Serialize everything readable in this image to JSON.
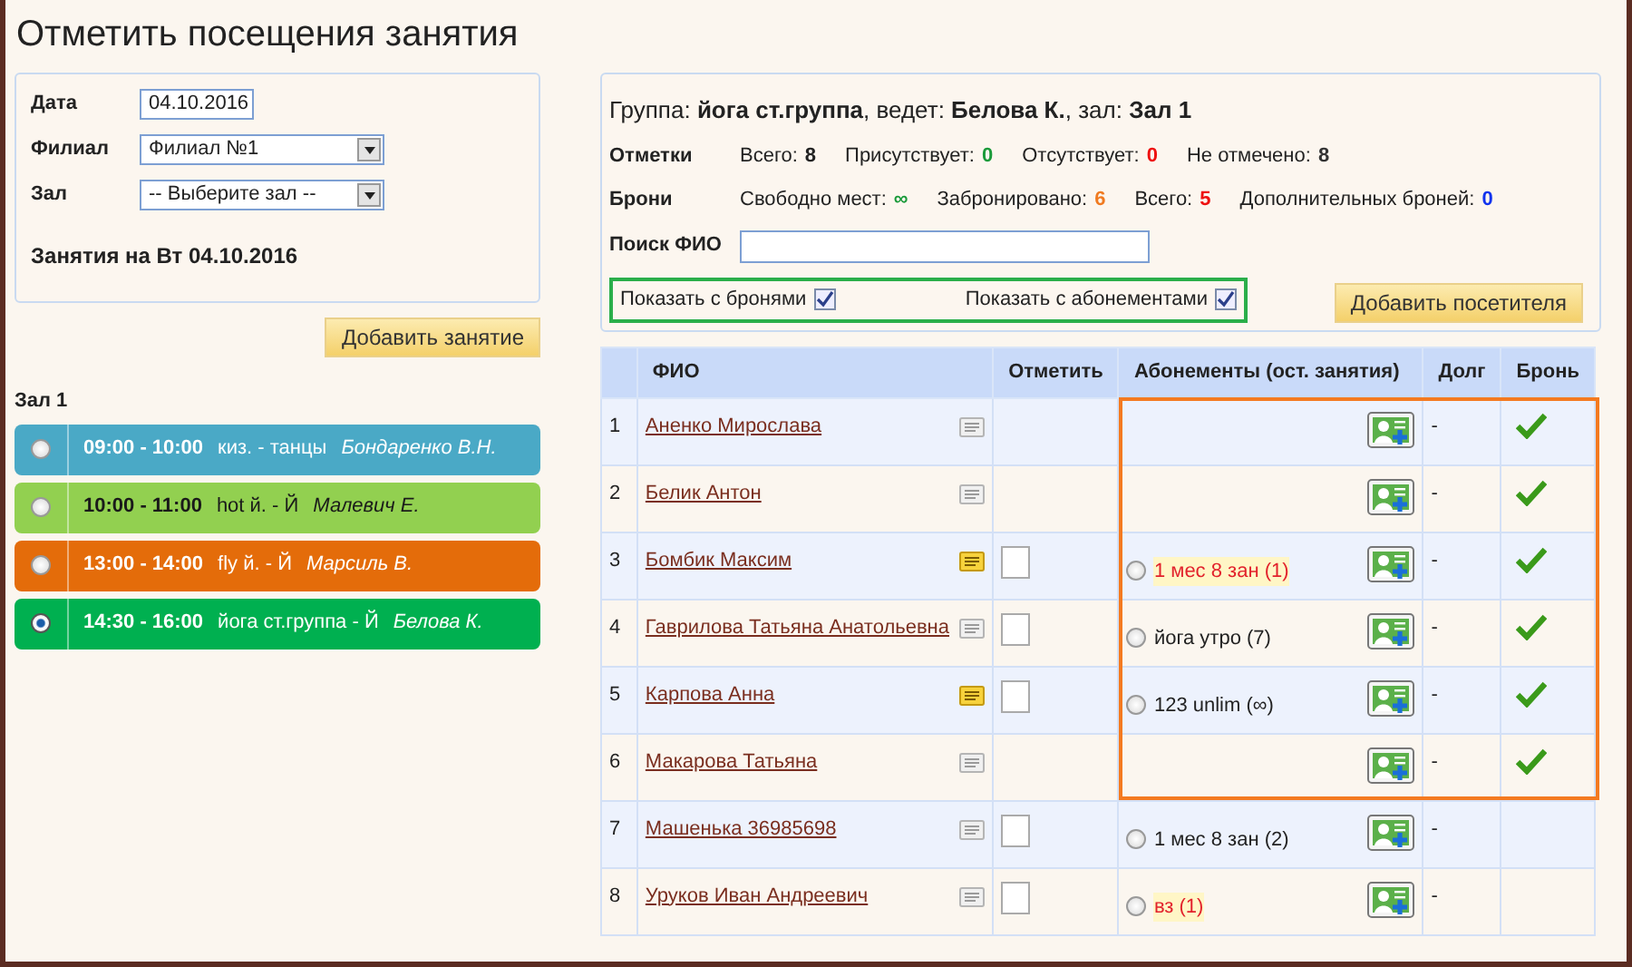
{
  "title": "Отметить посещения занятия",
  "filter": {
    "fields": [
      {
        "kind": "input",
        "label": "Дата",
        "value": "04.10.2016"
      },
      {
        "kind": "select",
        "label": "Филиал",
        "value": "Филиал №1"
      },
      {
        "kind": "select",
        "label": "Зал",
        "value": "-- Выберите зал --"
      }
    ],
    "heading": "Занятия на Вт 04.10.2016"
  },
  "add_lesson_button": "Добавить занятие",
  "hall_name": "Зал 1",
  "lessons": [
    {
      "time": "09:00 - 10:00",
      "name": "киз. - танцы",
      "teacher": "Бондаренко В.Н.",
      "color": "#4aa9c6",
      "selected": false
    },
    {
      "time": "10:00 - 11:00",
      "name": "hot й. - Й",
      "teacher": "Малевич Е.",
      "color": "#92d050",
      "selected": false
    },
    {
      "time": "13:00 - 14:00",
      "name": "fly й. - Й",
      "teacher": "Марсиль В.",
      "color": "#e46c0a",
      "selected": false
    },
    {
      "time": "14:30 - 16:00",
      "name": "йога ст.группа - Й",
      "teacher": "Белова К.",
      "color": "#00b050",
      "selected": true
    }
  ],
  "summary": {
    "group_line": "Группа: **йога ст.группа**, ведет: **Белова К.**, зал: **Зал 1**",
    "stats": [
      {
        "label": "Отметки",
        "items": [
          {
            "label": "Всего:",
            "value": "8",
            "color": "#222222"
          },
          {
            "label": "Присутствует:",
            "value": "0",
            "color": "#1a9a3a"
          },
          {
            "label": "Отсутствует:",
            "value": "0",
            "color": "#ee1111"
          },
          {
            "label": "Не отмечено:",
            "value": "8",
            "color": "#333333"
          }
        ]
      },
      {
        "label": "Брони",
        "items": [
          {
            "label": "Свободно мест:",
            "value": "∞",
            "color": "#1a9a3a"
          },
          {
            "label": "Забронировано:",
            "value": "6",
            "color": "#f07a20"
          },
          {
            "label": "Всего:",
            "value": "5",
            "color": "#ee1111"
          },
          {
            "label": "Дополнительных броней:",
            "value": "0",
            "color": "#1133ee"
          }
        ]
      }
    ],
    "search_label": "Поиск ФИО",
    "toggles": {
      "highlighted": true,
      "items": [
        {
          "label": "Показать с бронями",
          "checked": true
        },
        {
          "label": "Показать с абонементами",
          "checked": true
        }
      ]
    },
    "add_visitor_button": "Добавить посетителя"
  },
  "table": {
    "columns": [
      "ФИО",
      "Отметить",
      "Абонементы (ост. занятия)",
      "Долг",
      "Бронь"
    ],
    "rows": [
      {
        "number": "1",
        "name": "Аненко Мирослава",
        "note": false,
        "mark": null,
        "subscription": null,
        "debt": "-",
        "booked": true,
        "highlighted": true
      },
      {
        "number": "2",
        "name": "Белик Антон",
        "note": false,
        "mark": null,
        "subscription": null,
        "debt": "-",
        "booked": true,
        "highlighted": true
      },
      {
        "number": "3",
        "name": "Бомбик Максим",
        "note": true,
        "mark": {
          "checked": false
        },
        "subscription": {
          "text": "1 мес 8 зан (1)",
          "warn": true,
          "selected": false
        },
        "debt": "-",
        "booked": true,
        "highlighted": true
      },
      {
        "number": "4",
        "name": "Гаврилова Татьяна Анатольевна",
        "note": false,
        "mark": {
          "checked": false
        },
        "subscription": {
          "text": "йога утро (7)",
          "warn": false,
          "selected": false
        },
        "debt": "-",
        "booked": true,
        "highlighted": true
      },
      {
        "number": "5",
        "name": "Карпова Анна",
        "note": true,
        "mark": {
          "checked": false
        },
        "subscription": {
          "text": "123 unlim (∞)",
          "warn": false,
          "selected": false
        },
        "debt": "-",
        "booked": true,
        "highlighted": true
      },
      {
        "number": "6",
        "name": "Макарова Татьяна",
        "note": false,
        "mark": null,
        "subscription": null,
        "debt": "-",
        "booked": true,
        "highlighted": true
      },
      {
        "number": "7",
        "name": "Машенька 36985698",
        "note": false,
        "mark": {
          "checked": false
        },
        "subscription": {
          "text": "1 мес 8 зан (2)",
          "warn": false,
          "selected": false
        },
        "debt": "-",
        "booked": false,
        "highlighted": false
      },
      {
        "number": "8",
        "name": "Уруков Иван Андреевич",
        "note": false,
        "mark": {
          "checked": false
        },
        "subscription": {
          "text": "вз (1)",
          "warn": true,
          "selected": false
        },
        "debt": "-",
        "booked": false,
        "highlighted": false
      }
    ]
  }
}
